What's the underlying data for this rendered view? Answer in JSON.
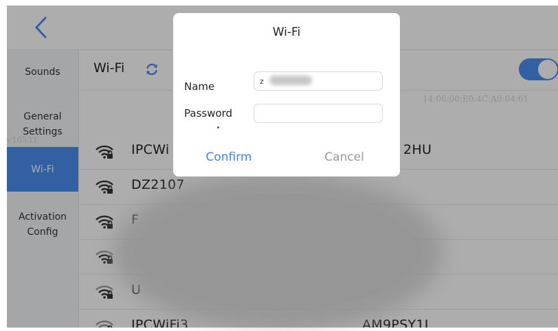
{
  "header": {
    "back_icon": "chevron-left-icon"
  },
  "sidebar": {
    "items": [
      {
        "label": "Sounds",
        "active": false
      },
      {
        "label": "General\nSettings",
        "active": false
      },
      {
        "label": "Wi-Fi",
        "active": true
      },
      {
        "label": "Activation\nConfig",
        "active": false
      }
    ],
    "version_text": "v16531"
  },
  "wifi": {
    "title": "Wi-Fi",
    "refresh_icon": "refresh-icon",
    "enabled": true,
    "mac_text": "14:06:00:E0:4C:A0:04:61",
    "networks": [
      {
        "ssid": "IPCWi",
        "ssid_tail": "2HU",
        "icon": "wifi-locked-icon"
      },
      {
        "ssid": "DZ2107",
        "ssid_tail": "",
        "icon": "wifi-locked-icon"
      },
      {
        "ssid": "F",
        "ssid_tail": "",
        "icon": "wifi-locked-icon"
      },
      {
        "ssid": "",
        "ssid_tail": "",
        "icon": "wifi-locked-icon"
      },
      {
        "ssid": "U",
        "ssid_tail": "",
        "icon": "wifi-locked-icon"
      },
      {
        "ssid": "IPCWiFi3",
        "ssid_tail": "AM9PSY1J",
        "icon": "wifi-locked-icon"
      }
    ]
  },
  "dialog": {
    "title": "Wi-Fi",
    "name_label": "Name",
    "name_value": "z",
    "password_label": "Password",
    "password_value": "",
    "confirm_label": "Confirm",
    "cancel_label": "Cancel"
  },
  "colors": {
    "accent": "#4a8ef1",
    "confirm_text": "#3d86ef",
    "cancel_text": "#9a9a9a"
  }
}
